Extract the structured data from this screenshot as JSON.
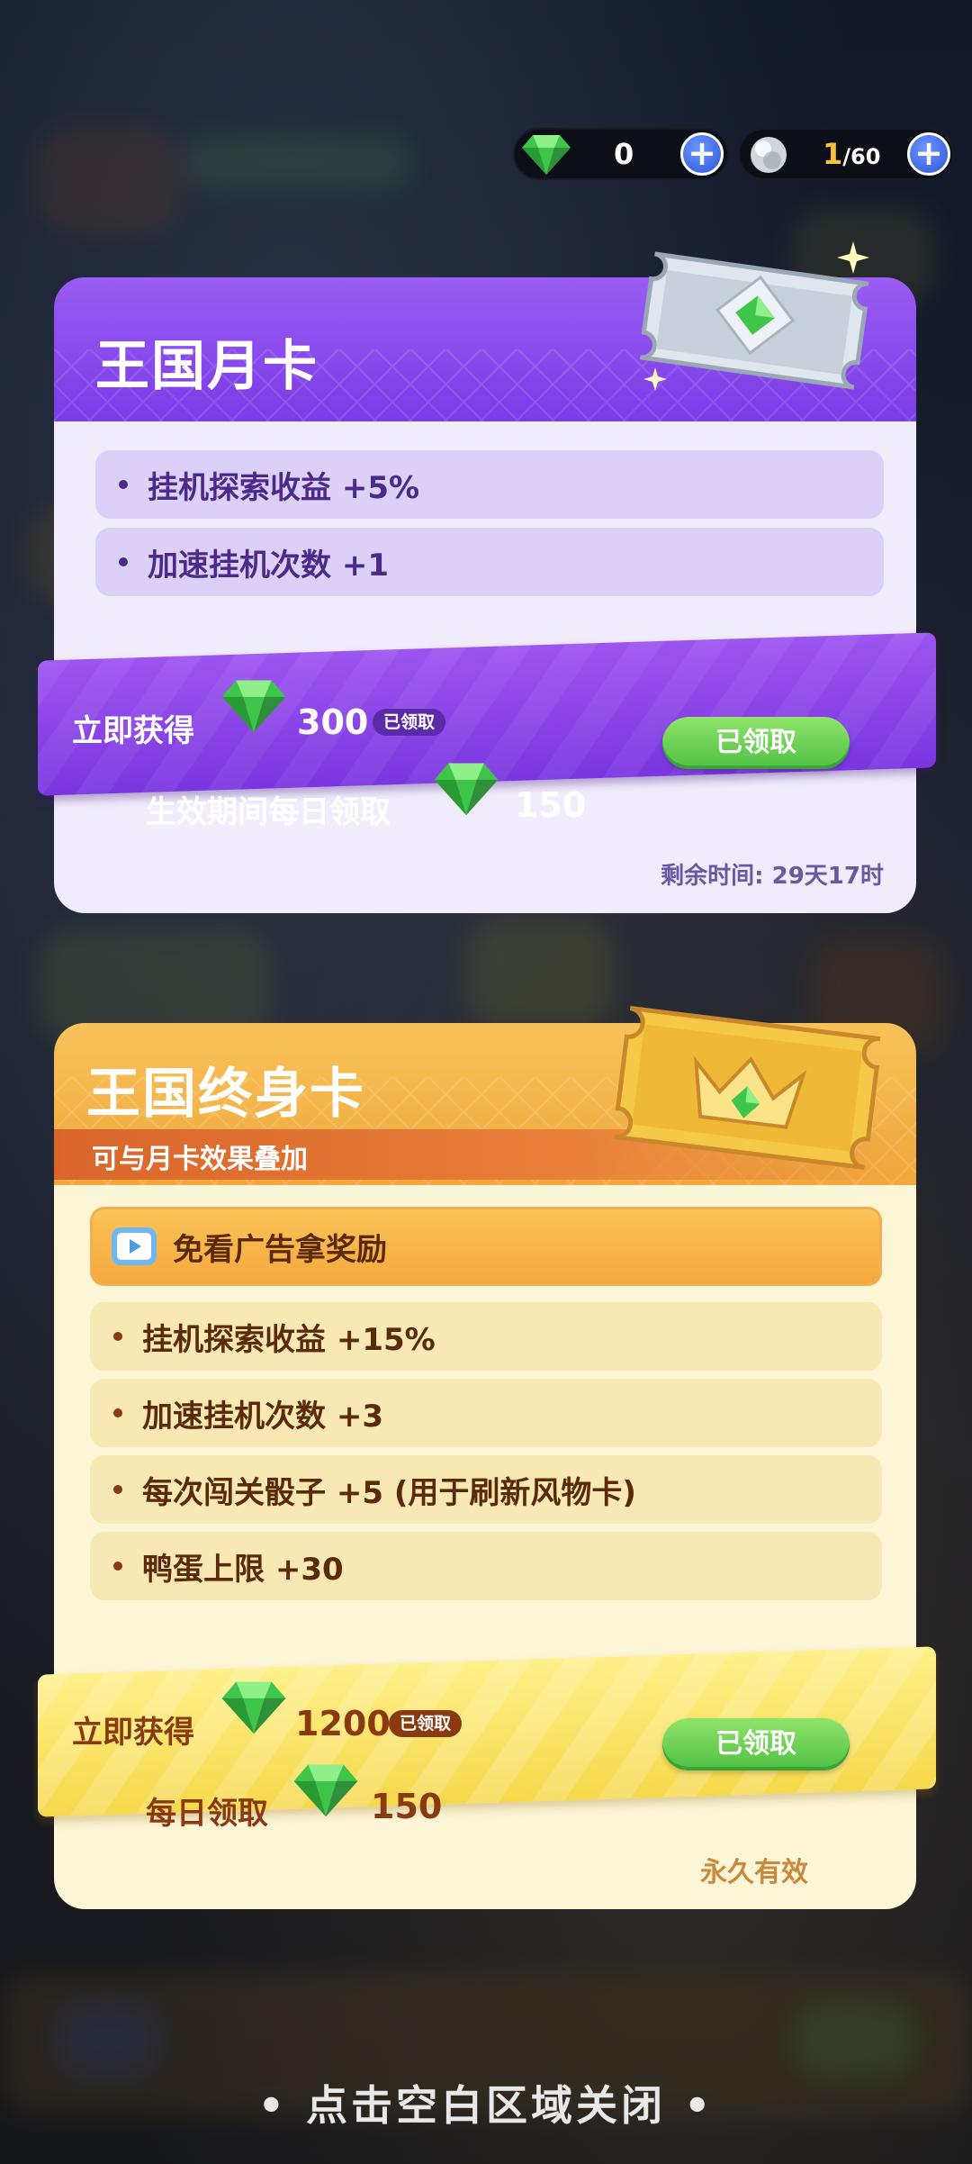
{
  "currency": {
    "gems": "0",
    "stamina_current": "1",
    "stamina_max": "/60",
    "gem_icon": "green-gem-icon",
    "stamina_icon": "silver-orb-icon",
    "add_icon": "plus-icon"
  },
  "monthly_card": {
    "title": "王国月卡",
    "benefits": [
      "挂机探索收益 +5%",
      "加速挂机次数 +1"
    ],
    "instant_label": "立即获得",
    "instant_amount": "300",
    "instant_badge": "已领取",
    "daily_label": "生效期间每日领取",
    "daily_amount": "150",
    "claim_button": "已领取",
    "remaining_time": "剩余时间: 29天17时",
    "accent": "#8a4cf0"
  },
  "lifetime_card": {
    "title": "王国终身卡",
    "subtitle": "可与月卡效果叠加",
    "ad_free": "免看广告拿奖励",
    "benefits": [
      "挂机探索收益 +15%",
      "加速挂机次数 +3",
      "每次闯关骰子 +5 (用于刷新风物卡)",
      "鸭蛋上限 +30"
    ],
    "instant_label": "立即获得",
    "instant_amount": "1200",
    "instant_badge": "已领取",
    "daily_label": "每日领取",
    "daily_amount": "150",
    "claim_button": "已领取",
    "validity": "永久有效",
    "accent": "#f0a534"
  },
  "footer": {
    "close_hint": "• 点击空白区域关闭 •"
  }
}
